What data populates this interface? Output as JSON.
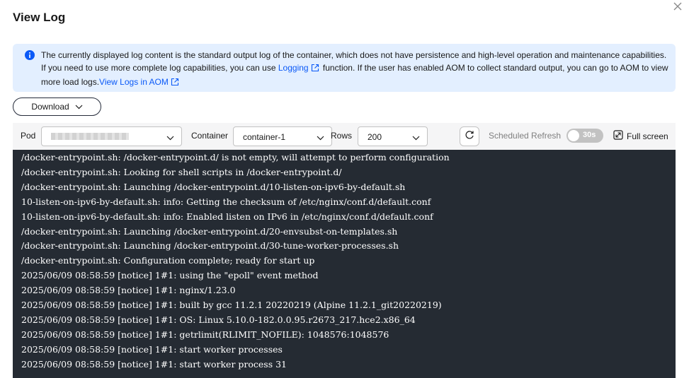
{
  "dialog": {
    "title": "View Log",
    "close_icon": "close-icon"
  },
  "notice": {
    "icon": "info-icon",
    "text_before": "The currently displayed log content is the standard output log of the container, which does not have persistence and high-level operation and maintenance capabilities. If you need to use more complete log capabilities, you can use ",
    "logging_link": "Logging",
    "text_middle": " function. If the user has enabled AOM to collect standard output, you can go to AOM to view more load logs.",
    "aom_link": "View Logs in AOM"
  },
  "download": {
    "label": "Download"
  },
  "toolbar": {
    "pod_label": "Pod",
    "pod_value": "",
    "container_label": "Container",
    "container_value": "container-1",
    "rows_label": "Rows",
    "rows_value": "200",
    "scheduled_refresh_label": "Scheduled Refresh",
    "refresh_interval": "30s",
    "refresh_enabled": false,
    "full_screen_label": "Full screen"
  },
  "log_lines": [
    "/docker-entrypoint.sh: /docker-entrypoint.d/ is not empty, will attempt to perform configuration",
    "/docker-entrypoint.sh: Looking for shell scripts in /docker-entrypoint.d/",
    "/docker-entrypoint.sh: Launching /docker-entrypoint.d/10-listen-on-ipv6-by-default.sh",
    "10-listen-on-ipv6-by-default.sh: info: Getting the checksum of /etc/nginx/conf.d/default.conf",
    "10-listen-on-ipv6-by-default.sh: info: Enabled listen on IPv6 in /etc/nginx/conf.d/default.conf",
    "/docker-entrypoint.sh: Launching /docker-entrypoint.d/20-envsubst-on-templates.sh",
    "/docker-entrypoint.sh: Launching /docker-entrypoint.d/30-tune-worker-processes.sh",
    "/docker-entrypoint.sh: Configuration complete; ready for start up",
    "2025/06/09 08:58:59 [notice] 1#1: using the \"epoll\" event method",
    "2025/06/09 08:58:59 [notice] 1#1: nginx/1.23.0",
    "2025/06/09 08:58:59 [notice] 1#1: built by gcc 11.2.1 20220219 (Alpine 11.2.1_git20220219)",
    "2025/06/09 08:58:59 [notice] 1#1: OS: Linux 5.10.0-182.0.0.95.r2673_217.hce2.x86_64",
    "2025/06/09 08:58:59 [notice] 1#1: getrlimit(RLIMIT_NOFILE): 1048576:1048576",
    "2025/06/09 08:58:59 [notice] 1#1: start worker processes",
    "2025/06/09 08:58:59 [notice] 1#1: start worker process 31"
  ],
  "colors": {
    "accent": "#0a59f7",
    "notice_bg": "#e3efff",
    "console_bg": "#252b33",
    "toolbar_bg": "#f5f5f6"
  }
}
